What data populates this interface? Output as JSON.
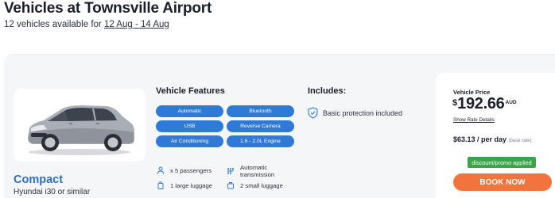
{
  "header": {
    "title": "Vehicles at Townsville Airport",
    "subtitle_prefix": "12 vehicles available for",
    "dates": "12 Aug - 14 Aug"
  },
  "vehicle": {
    "class": "Compact",
    "model": "Hyundai i30 or similar",
    "image_icon": "car-image"
  },
  "features": {
    "title": "Vehicle Features",
    "pills": [
      "Automatic",
      "Bluetooth",
      "USB",
      "Reverse Camera",
      "Air Conditioning",
      "1.6 - 2.0L Engine"
    ],
    "specs": {
      "passengers": "x 5 passengers",
      "transmission_line1": "Automatic",
      "transmission_line2": "transmission",
      "luggage": "1 large luggage",
      "small_luggage": "2 small luggage"
    },
    "icons": [
      "person-icon",
      "transmission-icon",
      "luggage-icon",
      "small-luggage-icon"
    ]
  },
  "includes": {
    "title": "Includes:",
    "item": "Basic protection included",
    "icon": "shield-check-icon"
  },
  "price": {
    "label": "Vehicle Price",
    "currency_symbol": "$",
    "amount": "192.66",
    "currency_code": "AUD",
    "rate_link": "Show Rate Details",
    "per_day": "$63.13 / per day",
    "base_rate": "(base rate)",
    "promo": "discount/promo applied",
    "book_label": "BOOK NOW"
  },
  "colors": {
    "accent_blue": "#2e7ad6",
    "class_blue": "#2d6fc4",
    "promo_green": "#3ba34a",
    "book_orange": "#f2743c"
  }
}
